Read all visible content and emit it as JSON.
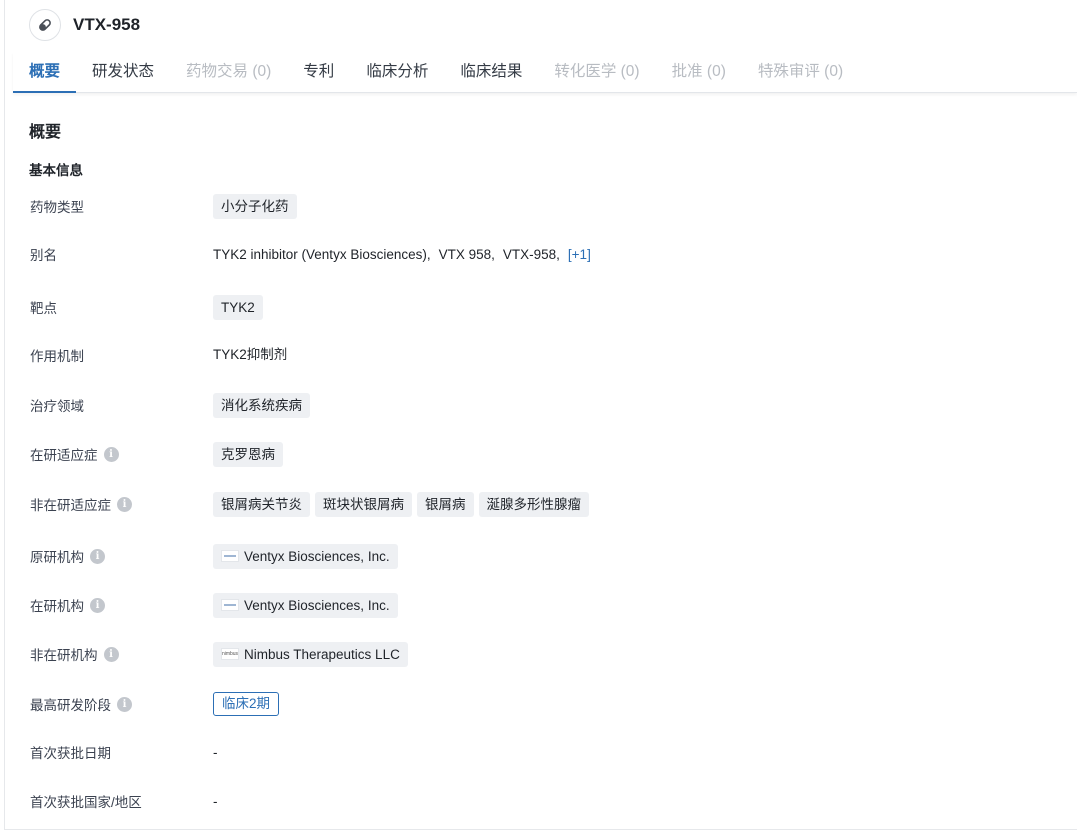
{
  "header": {
    "drug_name": "VTX-958",
    "icon": "pill-icon"
  },
  "tabs": [
    {
      "label": "概要",
      "state": "active"
    },
    {
      "label": "研发状态",
      "state": "normal"
    },
    {
      "label": "药物交易 (0)",
      "state": "disabled"
    },
    {
      "label": "专利",
      "state": "normal"
    },
    {
      "label": "临床分析",
      "state": "normal"
    },
    {
      "label": "临床结果",
      "state": "normal"
    },
    {
      "label": "转化医学 (0)",
      "state": "disabled"
    },
    {
      "label": "批准 (0)",
      "state": "disabled"
    },
    {
      "label": "特殊审评 (0)",
      "state": "disabled"
    }
  ],
  "overview": {
    "title": "概要",
    "basic_info_title": "基本信息",
    "fields": {
      "drug_type": {
        "label": "药物类型",
        "tags": [
          "小分子化药"
        ]
      },
      "aliases": {
        "label": "别名",
        "items": [
          "TYK2 inhibitor (Ventyx Biosciences),",
          "VTX 958,",
          "VTX-958,"
        ],
        "more": "[+1]"
      },
      "target": {
        "label": "靶点",
        "tags": [
          "TYK2"
        ]
      },
      "mechanism": {
        "label": "作用机制",
        "text": "TYK2抑制剂"
      },
      "therapeutic_area": {
        "label": "治疗领域",
        "tags": [
          "消化系统疾病"
        ]
      },
      "active_indications": {
        "label": "在研适应症",
        "tags": [
          "克罗恩病"
        ]
      },
      "inactive_indications": {
        "label": "非在研适应症",
        "tags": [
          "银屑病关节炎",
          "斑块状银屑病",
          "银屑病",
          "涎腺多形性腺瘤"
        ]
      },
      "originator": {
        "label": "原研机构",
        "org": "Ventyx Biosciences, Inc."
      },
      "active_org": {
        "label": "在研机构",
        "org": "Ventyx Biosciences, Inc."
      },
      "inactive_org": {
        "label": "非在研机构",
        "org": "Nimbus Therapeutics LLC",
        "logo_text": "nimbus"
      },
      "highest_phase": {
        "label": "最高研发阶段",
        "value": "临床2期"
      },
      "first_approval_date": {
        "label": "首次获批日期",
        "value": "-"
      },
      "first_approval_country": {
        "label": "首次获批国家/地区",
        "value": "-"
      }
    }
  },
  "colors": {
    "accent": "#2c6fb5",
    "tag_bg": "#eef0f3",
    "disabled_text": "#b8bcc2",
    "info_icon": "#c3c7cd"
  }
}
